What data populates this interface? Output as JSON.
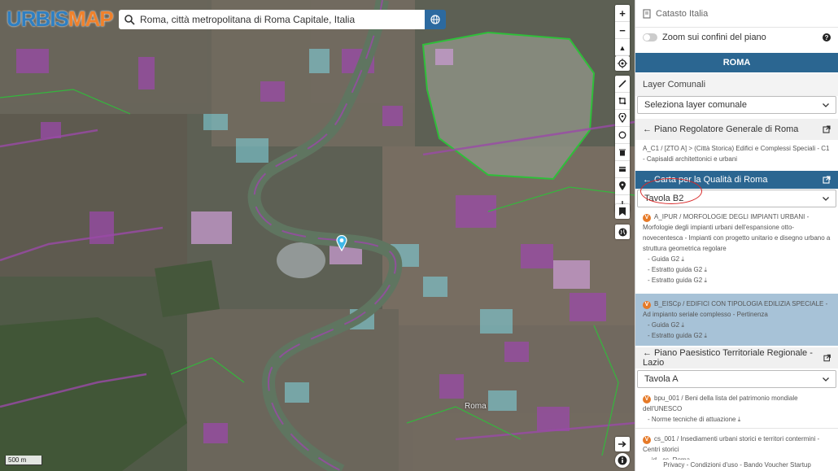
{
  "logo": {
    "part1": "URBIS",
    "part2": "MAP"
  },
  "search": {
    "value": "Roma, città metropolitana di Roma Capitale, Italia"
  },
  "map": {
    "scale_label": "500 m",
    "labels": {
      "roma": "Roma"
    },
    "tools": [
      "+",
      "−",
      "▲"
    ],
    "draw_tools": [
      "pencil-icon",
      "polygon-icon",
      "marker-icon",
      "circle-icon",
      "trash-icon",
      "layers-icon",
      "location-icon",
      "download-icon"
    ]
  },
  "panel": {
    "catasto": "Catasto Italia",
    "zoom_toggle": "Zoom sui confini del piano",
    "help": "?",
    "city": "ROMA",
    "layer_comunali": {
      "title": "Layer Comunali",
      "select": "Seleziona layer comunale"
    },
    "prg": {
      "title": "← Piano Regolatore Generale di Roma",
      "desc": "A_C1 / [ZTO A] > (Città Storica) Edifici e Complessi Speciali - C1 - Capisaldi architettonici e urbani"
    },
    "cqr": {
      "title": "← Carta per la Qualità di Roma",
      "select": "Tavola B2",
      "items": [
        {
          "badge": "V",
          "text": "A_IPUR / MORFOLOGIE DEGLI IMPIANTI URBANI - Morfologie degli impianti urbani dell'espansione otto-novecentesca - Impianti con progetto unitario e disegno urbano a struttura geometrica regolare",
          "links": [
            "- Guida G2 ⤓",
            "- Estratto guida G2 ⤓",
            "- Estratto guida G2 ⤓"
          ]
        },
        {
          "badge": "V",
          "text": "B_EISCp / EDIFICI CON TIPOLOGIA EDILIZIA SPECIALE - Ad impianto seriale complesso - Pertinenza",
          "links": [
            "- Guida G2 ⤓",
            "- Estratto guida G2 ⤓"
          ]
        }
      ]
    },
    "ptpr": {
      "title": "← Piano Paesistico Territoriale Regionale - Lazio",
      "select": "Tavola A",
      "items": [
        {
          "badge": "V",
          "text": "bpu_001 / Beni della lista del patrimonio mondiale dell'UNESCO",
          "links": [
            "- Norme tecniche di attuazione ⤓"
          ]
        },
        {
          "badge": "V",
          "text": "cs_001 / Insediamenti urbani storici e territori contermini - Centri storici",
          "links": [
            "- id - cs_Roma"
          ]
        }
      ]
    },
    "footer": "Privacy - Condizioni d'uso - Bando Voucher Startup"
  },
  "colors": {
    "brand_blue": "#2b6691",
    "brand_orange": "#f0812b",
    "highlight": "#a7c2d7",
    "badge": "#e67a28"
  }
}
